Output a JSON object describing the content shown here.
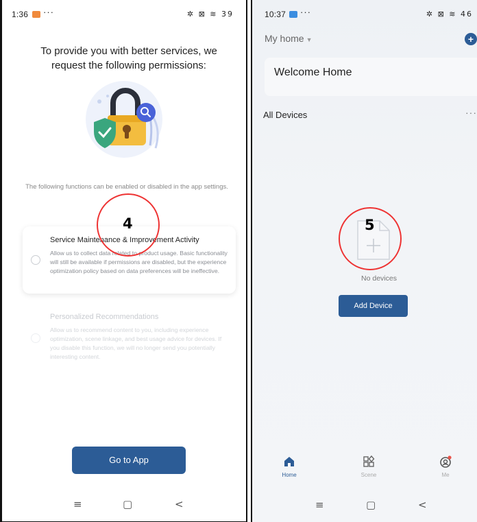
{
  "left": {
    "status": {
      "time": "1:36",
      "dots": "···",
      "icons": "✲ ⊠ ≋ 39",
      "app_color": "#f08a3c"
    },
    "title": "To provide you with better services, we request the following permissions:",
    "hint": "The following functions can be enabled or disabled in the app settings.",
    "cards": [
      {
        "title": "Service Maintenance & Improvement Activity",
        "desc": "Allow us to collect data related to product usage. Basic functionality will still be available if permissions are disabled, but the experience optimization policy based on data preferences will be ineffective."
      },
      {
        "title": "Personalized Recommendations",
        "desc": "Allow us to recommend content to you, including experience optimization, scene linkage, and best usage advice for devices. If you disable this function, we will no longer send you potentially interesting content."
      }
    ],
    "annotation": "4",
    "button": "Go to App"
  },
  "right": {
    "status": {
      "time": "10:37",
      "dots": "···",
      "icons": "✲ ⊠ ≋ 46",
      "app_color": "#3b8de0"
    },
    "home_selector": "My home",
    "welcome": "Welcome Home",
    "section": "All Devices",
    "more": "···",
    "annotation": "5",
    "empty_text": "No devices",
    "button": "Add Device",
    "tabs": [
      {
        "label": "Home",
        "icon": "home-icon",
        "active": true
      },
      {
        "label": "Scene",
        "icon": "scene-icon",
        "active": false
      },
      {
        "label": "Me",
        "icon": "me-icon",
        "active": false
      }
    ]
  },
  "nav": {
    "menu": "≡",
    "home": "▢",
    "back": "<"
  },
  "colors": {
    "accent": "#2c5c96",
    "annotation": "#e33333"
  }
}
